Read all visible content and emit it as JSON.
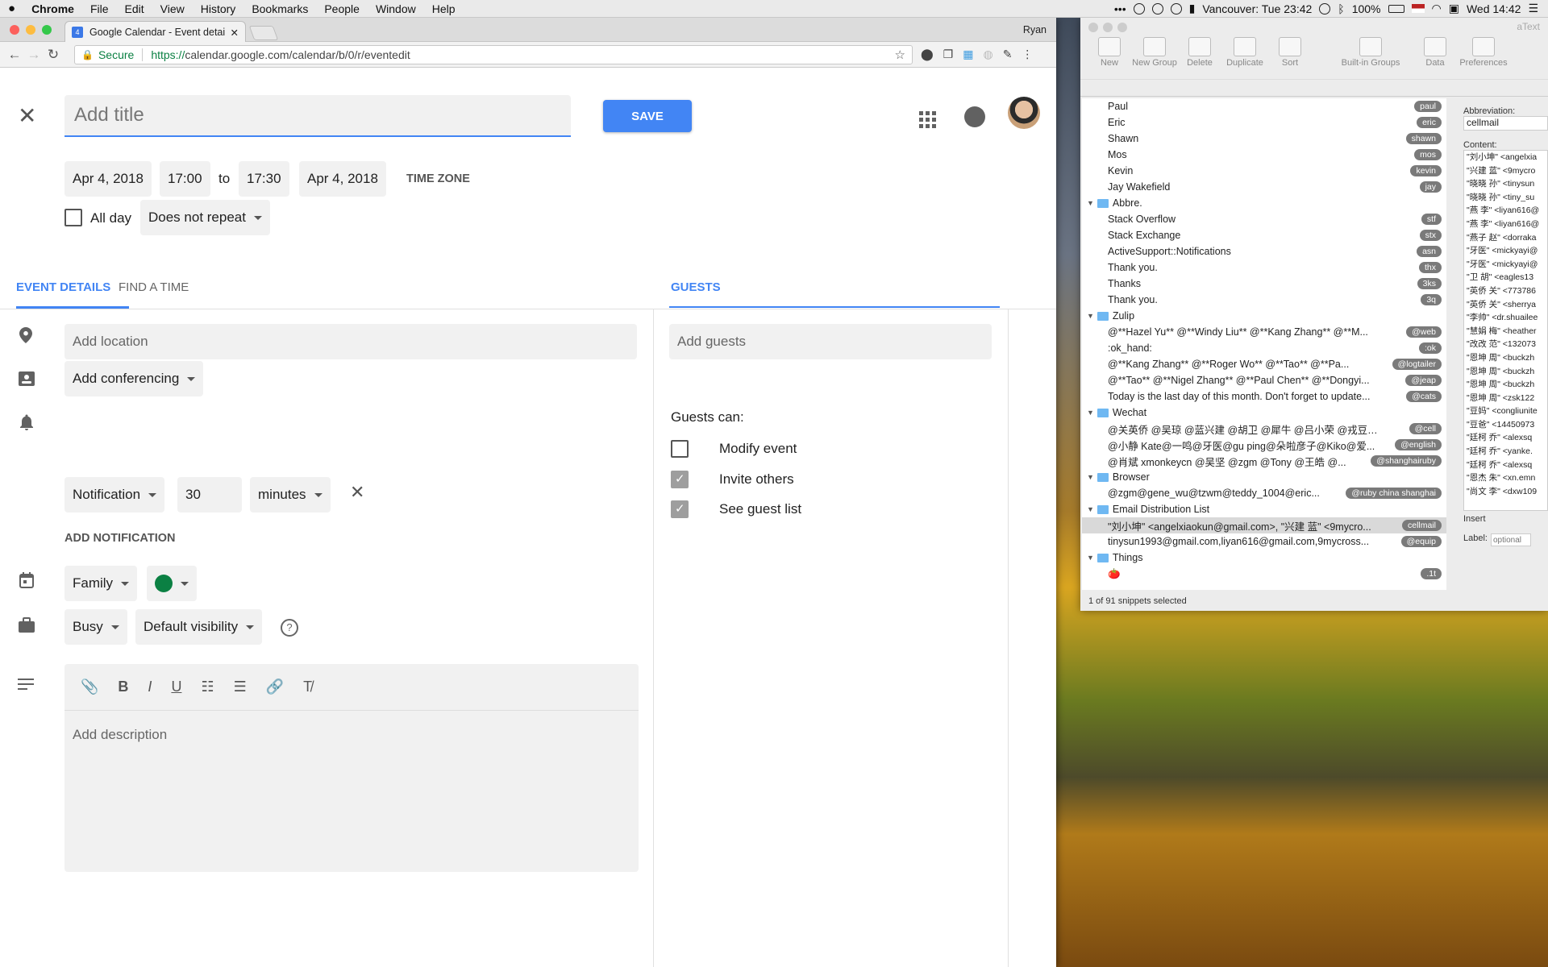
{
  "menubar": {
    "apple": "",
    "app": "Chrome",
    "items": [
      "File",
      "Edit",
      "View",
      "History",
      "Bookmarks",
      "People",
      "Window",
      "Help"
    ],
    "status": {
      "location_time": "Vancouver: Tue 23:42",
      "battery": "100%",
      "clock": "Wed 14:42"
    }
  },
  "browser": {
    "tab_title": "Google Calendar - Event detai",
    "profile": "Ryan",
    "secure_label": "Secure",
    "url_proto": "https://",
    "url_rest": "calendar.google.com/calendar/b/0/r/eventedit"
  },
  "event": {
    "title_placeholder": "Add title",
    "save_label": "SAVE",
    "start_date": "Apr 4, 2018",
    "start_time": "17:00",
    "to_label": "to",
    "end_time": "17:30",
    "end_date": "Apr 4, 2018",
    "timezone_label": "TIME ZONE",
    "all_day_label": "All day",
    "repeat": "Does not repeat",
    "tabs": {
      "details": "EVENT DETAILS",
      "find_time": "FIND A TIME",
      "guests": "GUESTS"
    },
    "location_placeholder": "Add location",
    "conferencing": "Add conferencing",
    "notification_type": "Notification",
    "notification_value": "30",
    "notification_unit": "minutes",
    "add_notification": "ADD NOTIFICATION",
    "calendar": "Family",
    "calendar_color": "#0b8043",
    "busy": "Busy",
    "visibility": "Default visibility",
    "description_placeholder": "Add description"
  },
  "guests": {
    "placeholder": "Add guests",
    "can_label": "Guests can:",
    "options": [
      {
        "label": "Modify event",
        "checked": false
      },
      {
        "label": "Invite others",
        "checked": true
      },
      {
        "label": "See guest list",
        "checked": true
      }
    ]
  },
  "atext": {
    "title": "aText",
    "toolbar": [
      "New",
      "New Group",
      "Delete",
      "Duplicate",
      "Sort",
      "Built-in Groups",
      "Data",
      "Preferences"
    ],
    "rows": [
      {
        "kind": "item",
        "label": "Paul",
        "abbr": "paul"
      },
      {
        "kind": "item",
        "label": "Eric",
        "abbr": "eric"
      },
      {
        "kind": "item",
        "label": "Shawn",
        "abbr": "shawn"
      },
      {
        "kind": "item",
        "label": "Mos",
        "abbr": "mos"
      },
      {
        "kind": "item",
        "label": "Kevin",
        "abbr": "kevin"
      },
      {
        "kind": "item",
        "label": "Jay Wakefield",
        "abbr": "jay"
      },
      {
        "kind": "group",
        "label": "Abbre.",
        "abbr": ""
      },
      {
        "kind": "item",
        "label": "Stack Overflow",
        "abbr": "stf"
      },
      {
        "kind": "item",
        "label": "Stack Exchange",
        "abbr": "stx"
      },
      {
        "kind": "item",
        "label": "ActiveSupport::Notifications",
        "abbr": "asn"
      },
      {
        "kind": "item",
        "label": "Thank you.",
        "abbr": "thx"
      },
      {
        "kind": "item",
        "label": "Thanks",
        "abbr": "3ks"
      },
      {
        "kind": "item",
        "label": "Thank you.",
        "abbr": "3q"
      },
      {
        "kind": "group",
        "label": "Zulip",
        "abbr": ""
      },
      {
        "kind": "item",
        "label": "@**Hazel Yu**  @**Windy Liu** @**Kang Zhang**  @**M...",
        "abbr": "@web"
      },
      {
        "kind": "item",
        "label": ":ok_hand:",
        "abbr": ":ok"
      },
      {
        "kind": "item",
        "label": "@**Kang Zhang**  @**Roger Wo** @**Tao**  @**Pa...",
        "abbr": "@logtailer"
      },
      {
        "kind": "item",
        "label": "@**Tao** @**Nigel Zhang**  @**Paul Chen** @**Dongyi...",
        "abbr": "@jeap"
      },
      {
        "kind": "item",
        "label": "Today is the last day of this month. Don't forget to update...",
        "abbr": "@cats"
      },
      {
        "kind": "group",
        "label": "Wechat",
        "abbr": ""
      },
      {
        "kind": "item",
        "label": "@关英侨 @吴琼 @蓝兴建 @胡卫 @犀牛 @吕小荣 @戎豆爸...",
        "abbr": "@cell"
      },
      {
        "kind": "item",
        "label": "@小静 Kate@一鸣@牙医@gu ping@朵啦彦子@Kiko@爱...",
        "abbr": "@english"
      },
      {
        "kind": "item",
        "label": "@肖斌 xmonkeycn @吴坚 @zgm @Tony @王皓 @...",
        "abbr": "@shanghairuby"
      },
      {
        "kind": "group",
        "label": "Browser",
        "abbr": ""
      },
      {
        "kind": "item",
        "label": "@zgm@gene_wu@tzwm@teddy_1004@eric...",
        "abbr": "@ruby china shanghai"
      },
      {
        "kind": "group",
        "label": "Email Distribution List",
        "abbr": ""
      },
      {
        "kind": "item",
        "label": "\"刘小坤\" <angelxiaokun@gmail.com>, \"兴建 蓝\" <9mycro...",
        "abbr": "cellmail",
        "selected": true
      },
      {
        "kind": "item",
        "label": "tinysun1993@gmail.com,liyan616@gmail.com,9mycross...",
        "abbr": "@equip"
      },
      {
        "kind": "group",
        "label": "Things",
        "abbr": ""
      },
      {
        "kind": "item",
        "label": "🍅",
        "abbr": ".1t"
      }
    ],
    "status": "1 of 91 snippets selected",
    "abbrev_label": "Abbreviation:",
    "abbrev_value": "cellmail",
    "content_label": "Content:",
    "content_lines": [
      "\"刘小坤\" <angelxia",
      "\"兴建 蓝\" <9mycro",
      "\"晓晓 孙\" <tinysun",
      "\"晓晓 孙\" <tiny_su",
      "\"燕 李\" <liyan616@",
      "\"燕 李\" <liyan616@",
      "\"燕子 赵\" <dorraka",
      "\"牙医\" <mickyayi@",
      "\"牙医\" <mickyayi@",
      "\"卫 胡\" <eagles13",
      "\"英侨 关\" <773786",
      "\"英侨 关\" <sherrya",
      "\"李帅\" <dr.shuailee",
      "\"慧娟 梅\" <heather",
      "\"改改 范\" <132073",
      "\"恩坤 周\" <buckzh",
      "\"恩坤 周\" <buckzh",
      "\"恩坤 周\" <buckzh",
      "\"恩坤 周\" <zsk122",
      "\"豆妈\" <congliunite",
      "\"豆爸\" <14450973",
      "\"廷柯 乔\" <alexsq",
      "\"廷柯 乔\" <yanke.",
      "\"廷柯 乔\" <alexsq",
      "\"恩杰 朱\" <xn.emn",
      "\"尚文 李\" <dxw109"
    ],
    "insert_label": "Insert",
    "label_label": "Label:",
    "label_placeholder": "optional"
  }
}
